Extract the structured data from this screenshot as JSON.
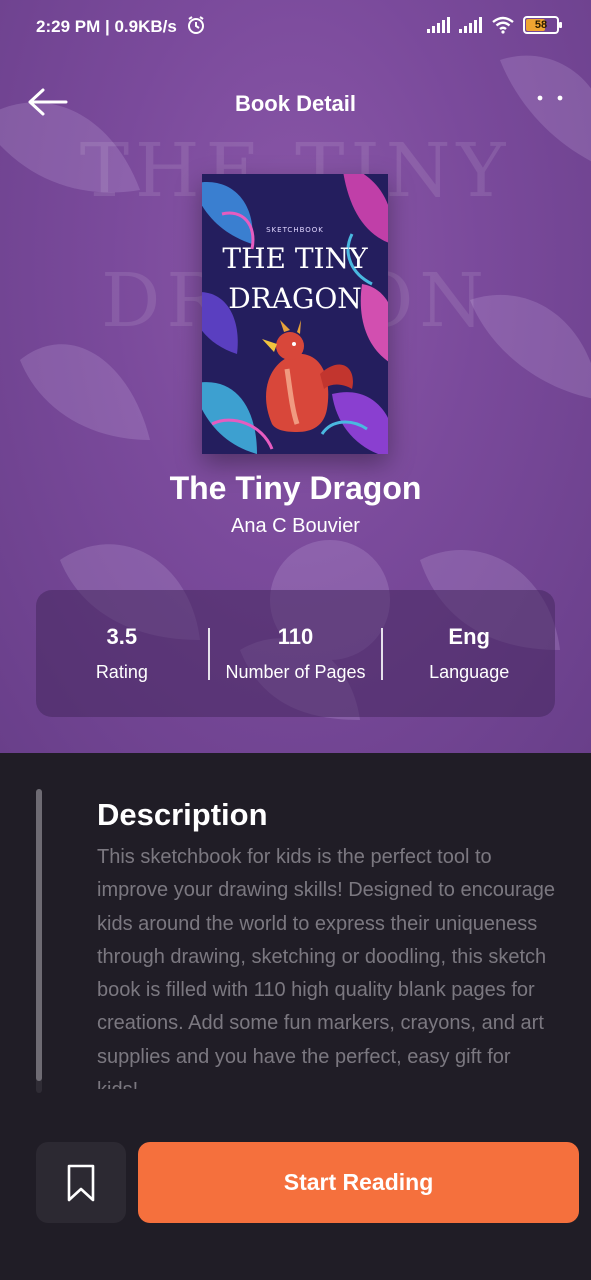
{
  "status_bar": {
    "time": "2:29 PM | 0.9KB/s",
    "battery": "58",
    "battery_color": "#f0a531"
  },
  "header": {
    "title": "Book Detail",
    "back_icon": "arrow-left-icon",
    "more_icon": "more-dots-icon"
  },
  "book": {
    "title": "The Tiny Dragon",
    "author": "Ana C Bouvier",
    "cover": {
      "kicker": "SKETCHBOOK",
      "line1": "THE TINY",
      "line2": "DRAGON"
    }
  },
  "stats": [
    {
      "value": "3.5",
      "label": "Rating"
    },
    {
      "value": "110",
      "label": "Number of Pages"
    },
    {
      "value": "Eng",
      "label": "Language"
    }
  ],
  "description": {
    "title": "Description",
    "text": "This sketchbook for kids is the perfect tool to improve your drawing skills! Designed to encourage kids around the world to express their uniqueness through drawing, sketching or doodling, this sketch book is filled with 110 high quality blank pages for creations. Add some fun markers, crayons, and art supplies and you have the perfect, easy gift for kids!"
  },
  "actions": {
    "bookmark_icon": "bookmark-icon",
    "start_label": "Start Reading",
    "accent_color": "#f5703d"
  },
  "theme": {
    "hero_color": "#7a4a9b",
    "dark_bg": "#201d26"
  }
}
